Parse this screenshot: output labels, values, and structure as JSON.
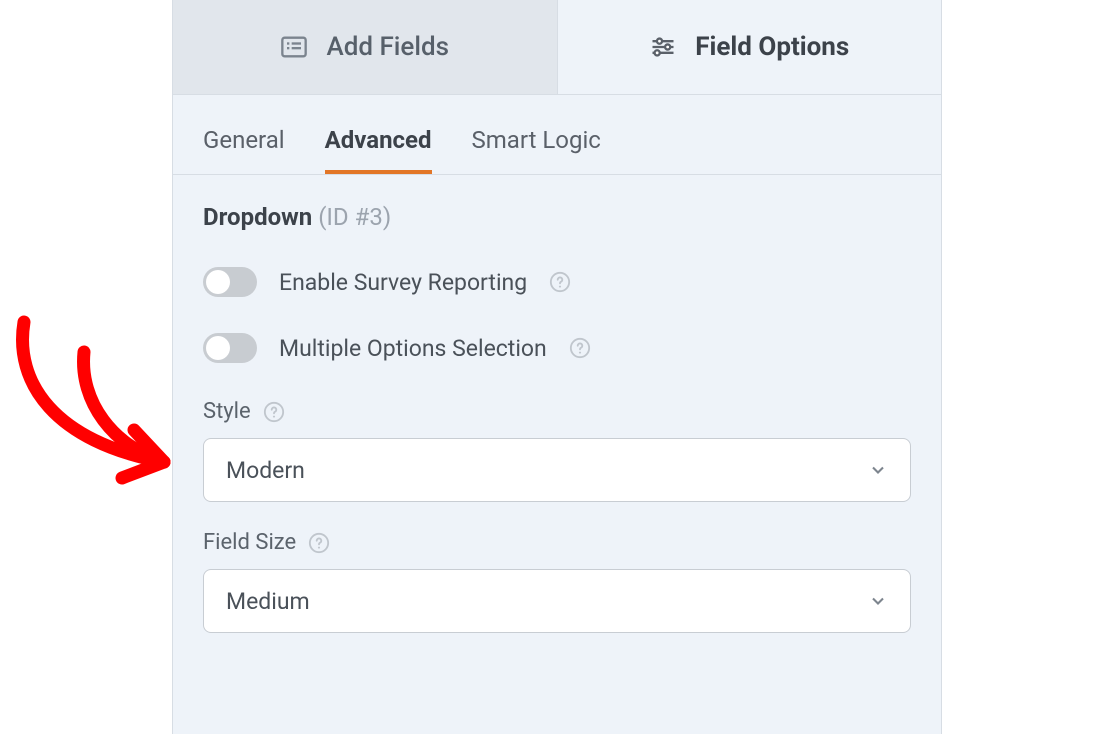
{
  "top_tabs": {
    "add_fields": "Add Fields",
    "field_options": "Field Options"
  },
  "sub_tabs": {
    "general": "General",
    "advanced": "Advanced",
    "smart_logic": "Smart Logic"
  },
  "heading": {
    "title": "Dropdown",
    "id_text": "(ID #3)"
  },
  "toggles": {
    "survey_reporting": "Enable Survey Reporting",
    "multiple_selection": "Multiple Options Selection"
  },
  "fields": {
    "style": {
      "label": "Style",
      "value": "Modern"
    },
    "field_size": {
      "label": "Field Size",
      "value": "Medium"
    }
  }
}
